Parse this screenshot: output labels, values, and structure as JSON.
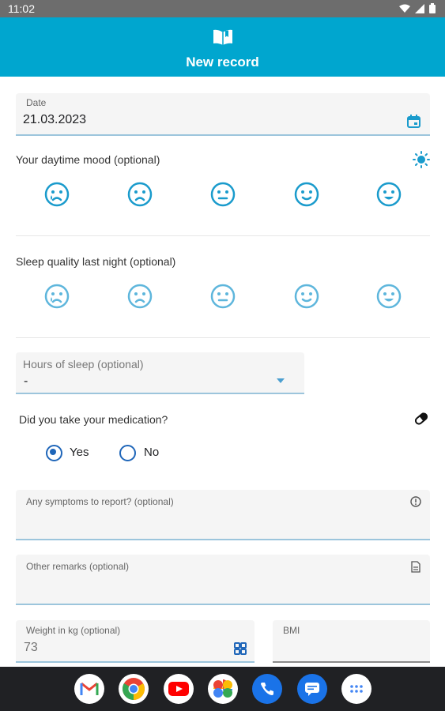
{
  "status_bar": {
    "time": "11:02"
  },
  "app_bar": {
    "title": "New record",
    "icon": "book-open-icon"
  },
  "date_field": {
    "label": "Date",
    "value": "21.03.2023",
    "icon": "calendar-icon"
  },
  "mood": {
    "label": "Your daytime mood (optional)",
    "icon": "sun-icon",
    "options": [
      "very-sad-face-icon",
      "sad-face-icon",
      "neutral-face-icon",
      "smile-face-icon",
      "happy-face-icon"
    ]
  },
  "sleep": {
    "label": "Sleep quality last night (optional)",
    "icon": "moon-icon",
    "options": [
      "very-sad-face-icon",
      "sad-face-icon",
      "neutral-face-icon",
      "smile-face-icon",
      "happy-face-icon"
    ]
  },
  "hours_of_sleep": {
    "label": "Hours of sleep (optional)",
    "value": "-"
  },
  "medication": {
    "question": "Did you take your medication?",
    "icon": "pill-icon",
    "options": [
      {
        "label": "Yes",
        "selected": true
      },
      {
        "label": "No",
        "selected": false
      }
    ]
  },
  "symptoms": {
    "label": "Any symptoms to report? (optional)",
    "icon": "info-icon"
  },
  "remarks": {
    "label": "Other remarks (optional)",
    "icon": "document-icon"
  },
  "weight": {
    "label": "Weight in kg (optional)",
    "placeholder": "73",
    "icon": "keypad-icon"
  },
  "bmi": {
    "label": "BMI"
  },
  "colors": {
    "accent": "#00a6cf",
    "icon_blue": "#1a9bcc",
    "radio": "#1f66b9"
  },
  "dock_apps": [
    "gmail-icon",
    "chrome-icon",
    "youtube-icon",
    "photos-icon",
    "phone-icon",
    "messages-icon",
    "app-drawer-icon"
  ]
}
